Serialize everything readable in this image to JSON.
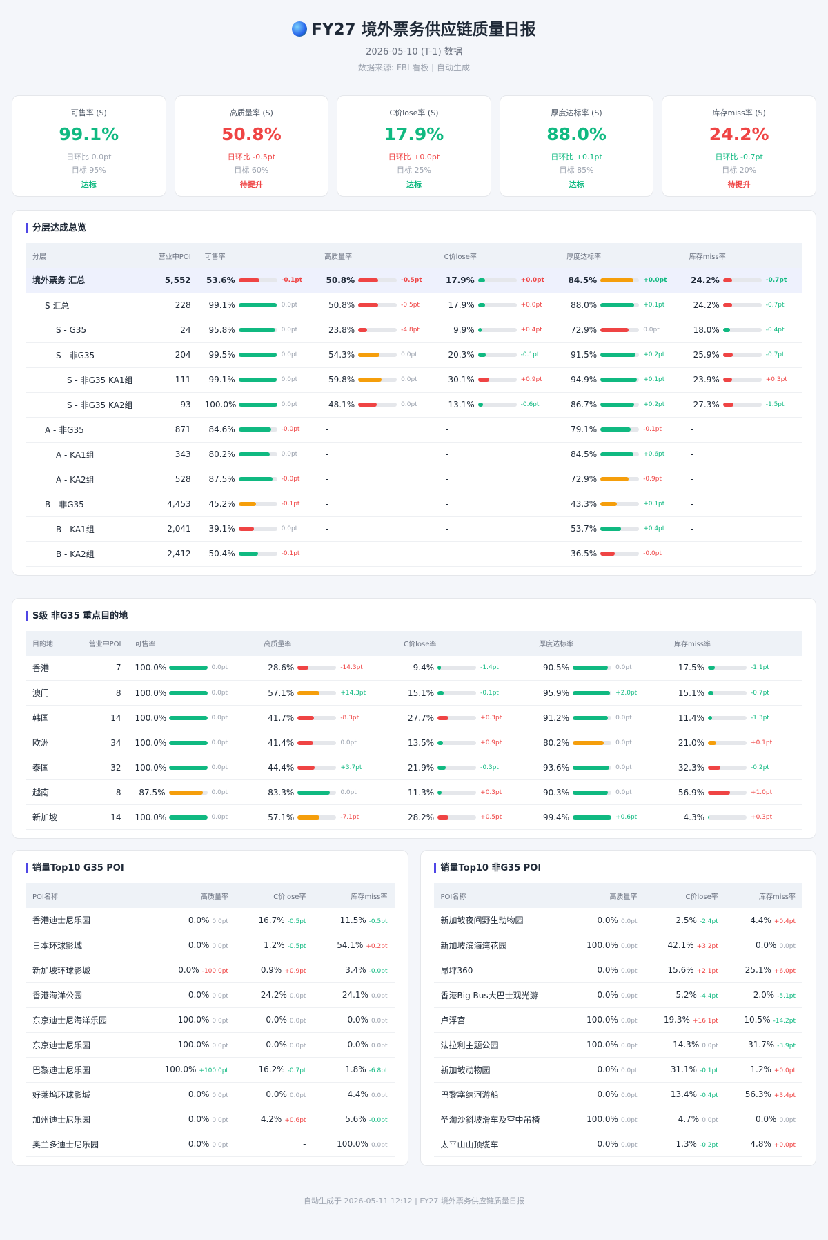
{
  "header": {
    "title": "FY27 境外票务供应链质量日报",
    "date_line": "2026-05-10 (T-1) 数据",
    "source_line": "数据来源: FBI 看板 | 自动生成"
  },
  "kpis": [
    {
      "title": "可售率 (S)",
      "value": "99.1%",
      "delta": "日环比 0.0pt",
      "target": "目标 95%",
      "status": "达标",
      "value_color": "green",
      "delta_color": "gray",
      "status_color": "green"
    },
    {
      "title": "高质量率 (S)",
      "value": "50.8%",
      "delta": "日环比 -0.5pt",
      "target": "目标 60%",
      "status": "待提升",
      "value_color": "red",
      "delta_color": "red",
      "status_color": "red"
    },
    {
      "title": "C价lose率 (S)",
      "value": "17.9%",
      "delta": "日环比 +0.0pt",
      "target": "目标 25%",
      "status": "达标",
      "value_color": "green",
      "delta_color": "red",
      "status_color": "green"
    },
    {
      "title": "厚度达标率 (S)",
      "value": "88.0%",
      "delta": "日环比 +0.1pt",
      "target": "目标 85%",
      "status": "达标",
      "value_color": "green",
      "delta_color": "green",
      "status_color": "green"
    },
    {
      "title": "库存miss率 (S)",
      "value": "24.2%",
      "delta": "日环比 -0.7pt",
      "target": "目标 20%",
      "status": "待提升",
      "value_color": "red",
      "delta_color": "green",
      "status_color": "red"
    }
  ],
  "colors": {
    "green": "#10b981",
    "red": "#ef4444",
    "orange": "#f59e0b",
    "gray": "#9ca3af"
  },
  "tier_section": {
    "title": "分层达成总览",
    "columns": [
      "分层",
      "营业中POI",
      "可售率",
      "高质量率",
      "C价lose率",
      "厚度达标率",
      "库存miss率"
    ],
    "rows": [
      {
        "name": "境外票务 汇总",
        "indent": 0,
        "summary": true,
        "poi": "5,552",
        "m": [
          [
            "53.6%",
            "-0.1pt",
            "red",
            "red"
          ],
          [
            "50.8%",
            "-0.5pt",
            "red",
            "red"
          ],
          [
            "17.9%",
            "+0.0pt",
            "green",
            "red"
          ],
          [
            "84.5%",
            "+0.0pt",
            "orange",
            "green"
          ],
          [
            "24.2%",
            "-0.7pt",
            "red",
            "green"
          ]
        ]
      },
      {
        "name": "S 汇总",
        "indent": 1,
        "poi": "228",
        "m": [
          [
            "99.1%",
            "0.0pt",
            "green",
            "gray"
          ],
          [
            "50.8%",
            "-0.5pt",
            "red",
            "red"
          ],
          [
            "17.9%",
            "+0.0pt",
            "green",
            "red"
          ],
          [
            "88.0%",
            "+0.1pt",
            "green",
            "green"
          ],
          [
            "24.2%",
            "-0.7pt",
            "red",
            "green"
          ]
        ]
      },
      {
        "name": "S - G35",
        "indent": 2,
        "poi": "24",
        "m": [
          [
            "95.8%",
            "0.0pt",
            "green",
            "gray"
          ],
          [
            "23.8%",
            "-4.8pt",
            "red",
            "red"
          ],
          [
            "9.9%",
            "+0.4pt",
            "green",
            "red"
          ],
          [
            "72.9%",
            "0.0pt",
            "red",
            "gray"
          ],
          [
            "18.0%",
            "-0.4pt",
            "green",
            "green"
          ]
        ]
      },
      {
        "name": "S - 非G35",
        "indent": 2,
        "poi": "204",
        "m": [
          [
            "99.5%",
            "0.0pt",
            "green",
            "gray"
          ],
          [
            "54.3%",
            "0.0pt",
            "orange",
            "gray"
          ],
          [
            "20.3%",
            "-0.1pt",
            "green",
            "green"
          ],
          [
            "91.5%",
            "+0.2pt",
            "green",
            "green"
          ],
          [
            "25.9%",
            "-0.7pt",
            "red",
            "green"
          ]
        ]
      },
      {
        "name": "S - 非G35 KA1组",
        "indent": 3,
        "poi": "111",
        "m": [
          [
            "99.1%",
            "0.0pt",
            "green",
            "gray"
          ],
          [
            "59.8%",
            "0.0pt",
            "orange",
            "gray"
          ],
          [
            "30.1%",
            "+0.9pt",
            "red",
            "red"
          ],
          [
            "94.9%",
            "+0.1pt",
            "green",
            "green"
          ],
          [
            "23.9%",
            "+0.3pt",
            "red",
            "red"
          ]
        ]
      },
      {
        "name": "S - 非G35 KA2组",
        "indent": 3,
        "poi": "93",
        "m": [
          [
            "100.0%",
            "0.0pt",
            "green",
            "gray"
          ],
          [
            "48.1%",
            "0.0pt",
            "red",
            "gray"
          ],
          [
            "13.1%",
            "-0.6pt",
            "green",
            "green"
          ],
          [
            "86.7%",
            "+0.2pt",
            "green",
            "green"
          ],
          [
            "27.3%",
            "-1.5pt",
            "red",
            "green"
          ]
        ]
      },
      {
        "name": "A - 非G35",
        "indent": 1,
        "poi": "871",
        "m": [
          [
            "84.6%",
            "-0.0pt",
            "green",
            "red"
          ],
          null,
          null,
          [
            "79.1%",
            "-0.1pt",
            "green",
            "red"
          ],
          null
        ]
      },
      {
        "name": "A - KA1组",
        "indent": 2,
        "poi": "343",
        "m": [
          [
            "80.2%",
            "0.0pt",
            "green",
            "gray"
          ],
          null,
          null,
          [
            "84.5%",
            "+0.6pt",
            "green",
            "green"
          ],
          null
        ]
      },
      {
        "name": "A - KA2组",
        "indent": 2,
        "poi": "528",
        "m": [
          [
            "87.5%",
            "-0.0pt",
            "green",
            "red"
          ],
          null,
          null,
          [
            "72.9%",
            "-0.9pt",
            "orange",
            "red"
          ],
          null
        ]
      },
      {
        "name": "B - 非G35",
        "indent": 1,
        "poi": "4,453",
        "m": [
          [
            "45.2%",
            "-0.1pt",
            "orange",
            "red"
          ],
          null,
          null,
          [
            "43.3%",
            "+0.1pt",
            "orange",
            "green"
          ],
          null
        ]
      },
      {
        "name": "B - KA1组",
        "indent": 2,
        "poi": "2,041",
        "m": [
          [
            "39.1%",
            "0.0pt",
            "red",
            "gray"
          ],
          null,
          null,
          [
            "53.7%",
            "+0.4pt",
            "green",
            "green"
          ],
          null
        ]
      },
      {
        "name": "B - KA2组",
        "indent": 2,
        "poi": "2,412",
        "m": [
          [
            "50.4%",
            "-0.1pt",
            "green",
            "red"
          ],
          null,
          null,
          [
            "36.5%",
            "-0.0pt",
            "red",
            "red"
          ],
          null
        ]
      }
    ],
    "dash": "-"
  },
  "dest_section": {
    "title": "S级 非G35 重点目的地",
    "columns": [
      "目的地",
      "营业中POI",
      "可售率",
      "高质量率",
      "C价lose率",
      "厚度达标率",
      "库存miss率"
    ],
    "rows": [
      {
        "name": "香港",
        "poi": "7",
        "m": [
          [
            "100.0%",
            "0.0pt",
            "green",
            "gray"
          ],
          [
            "28.6%",
            "-14.3pt",
            "red",
            "red"
          ],
          [
            "9.4%",
            "-1.4pt",
            "green",
            "green"
          ],
          [
            "90.5%",
            "0.0pt",
            "green",
            "gray"
          ],
          [
            "17.5%",
            "-1.1pt",
            "green",
            "green"
          ]
        ]
      },
      {
        "name": "澳门",
        "poi": "8",
        "m": [
          [
            "100.0%",
            "0.0pt",
            "green",
            "gray"
          ],
          [
            "57.1%",
            "+14.3pt",
            "orange",
            "green"
          ],
          [
            "15.1%",
            "-0.1pt",
            "green",
            "green"
          ],
          [
            "95.9%",
            "+2.0pt",
            "green",
            "green"
          ],
          [
            "15.1%",
            "-0.7pt",
            "green",
            "green"
          ]
        ]
      },
      {
        "name": "韩国",
        "poi": "14",
        "m": [
          [
            "100.0%",
            "0.0pt",
            "green",
            "gray"
          ],
          [
            "41.7%",
            "-8.3pt",
            "red",
            "red"
          ],
          [
            "27.7%",
            "+0.3pt",
            "red",
            "red"
          ],
          [
            "91.2%",
            "0.0pt",
            "green",
            "gray"
          ],
          [
            "11.4%",
            "-1.3pt",
            "green",
            "green"
          ]
        ]
      },
      {
        "name": "欧洲",
        "poi": "34",
        "m": [
          [
            "100.0%",
            "0.0pt",
            "green",
            "gray"
          ],
          [
            "41.4%",
            "0.0pt",
            "red",
            "gray"
          ],
          [
            "13.5%",
            "+0.9pt",
            "green",
            "red"
          ],
          [
            "80.2%",
            "0.0pt",
            "orange",
            "gray"
          ],
          [
            "21.0%",
            "+0.1pt",
            "orange",
            "red"
          ]
        ]
      },
      {
        "name": "泰国",
        "poi": "32",
        "m": [
          [
            "100.0%",
            "0.0pt",
            "green",
            "gray"
          ],
          [
            "44.4%",
            "+3.7pt",
            "red",
            "green"
          ],
          [
            "21.9%",
            "-0.3pt",
            "green",
            "green"
          ],
          [
            "93.6%",
            "0.0pt",
            "green",
            "gray"
          ],
          [
            "32.3%",
            "-0.2pt",
            "red",
            "green"
          ]
        ]
      },
      {
        "name": "越南",
        "poi": "8",
        "m": [
          [
            "87.5%",
            "0.0pt",
            "orange",
            "gray"
          ],
          [
            "83.3%",
            "0.0pt",
            "green",
            "gray"
          ],
          [
            "11.3%",
            "+0.3pt",
            "green",
            "red"
          ],
          [
            "90.3%",
            "0.0pt",
            "green",
            "gray"
          ],
          [
            "56.9%",
            "+1.0pt",
            "red",
            "red"
          ]
        ]
      },
      {
        "name": "新加坡",
        "poi": "14",
        "m": [
          [
            "100.0%",
            "0.0pt",
            "green",
            "gray"
          ],
          [
            "57.1%",
            "-7.1pt",
            "orange",
            "red"
          ],
          [
            "28.2%",
            "+0.5pt",
            "red",
            "red"
          ],
          [
            "99.4%",
            "+0.6pt",
            "green",
            "green"
          ],
          [
            "4.3%",
            "+0.3pt",
            "green",
            "red"
          ]
        ]
      }
    ]
  },
  "top_g35": {
    "title": "销量Top10 G35 POI",
    "columns": [
      "POI名称",
      "高质量率",
      "C价lose率",
      "库存miss率"
    ],
    "rows": [
      {
        "name": "香港迪士尼乐园",
        "c": [
          [
            "0.0%",
            "0.0pt",
            "gray"
          ],
          [
            "16.7%",
            "-0.5pt",
            "green"
          ],
          [
            "11.5%",
            "-0.5pt",
            "green"
          ]
        ]
      },
      {
        "name": "日本环球影城",
        "c": [
          [
            "0.0%",
            "0.0pt",
            "gray"
          ],
          [
            "1.2%",
            "-0.5pt",
            "green"
          ],
          [
            "54.1%",
            "+0.2pt",
            "red"
          ]
        ]
      },
      {
        "name": "新加坡环球影城",
        "c": [
          [
            "0.0%",
            "-100.0pt",
            "red"
          ],
          [
            "0.9%",
            "+0.9pt",
            "red"
          ],
          [
            "3.4%",
            "-0.0pt",
            "green"
          ]
        ]
      },
      {
        "name": "香港海洋公园",
        "c": [
          [
            "0.0%",
            "0.0pt",
            "gray"
          ],
          [
            "24.2%",
            "0.0pt",
            "gray"
          ],
          [
            "24.1%",
            "0.0pt",
            "gray"
          ]
        ]
      },
      {
        "name": "东京迪士尼海洋乐园",
        "c": [
          [
            "100.0%",
            "0.0pt",
            "gray"
          ],
          [
            "0.0%",
            "0.0pt",
            "gray"
          ],
          [
            "0.0%",
            "0.0pt",
            "gray"
          ]
        ]
      },
      {
        "name": "东京迪士尼乐园",
        "c": [
          [
            "100.0%",
            "0.0pt",
            "gray"
          ],
          [
            "0.0%",
            "0.0pt",
            "gray"
          ],
          [
            "0.0%",
            "0.0pt",
            "gray"
          ]
        ]
      },
      {
        "name": "巴黎迪士尼乐园",
        "c": [
          [
            "100.0%",
            "+100.0pt",
            "green"
          ],
          [
            "16.2%",
            "-0.7pt",
            "green"
          ],
          [
            "1.8%",
            "-6.8pt",
            "green"
          ]
        ]
      },
      {
        "name": "好莱坞环球影城",
        "c": [
          [
            "0.0%",
            "0.0pt",
            "gray"
          ],
          [
            "0.0%",
            "0.0pt",
            "gray"
          ],
          [
            "4.4%",
            "0.0pt",
            "gray"
          ]
        ]
      },
      {
        "name": "加州迪士尼乐园",
        "c": [
          [
            "0.0%",
            "0.0pt",
            "gray"
          ],
          [
            "4.2%",
            "+0.6pt",
            "red"
          ],
          [
            "5.6%",
            "-0.0pt",
            "green"
          ]
        ]
      },
      {
        "name": "奥兰多迪士尼乐园",
        "c": [
          [
            "0.0%",
            "0.0pt",
            "gray"
          ],
          null,
          [
            "100.0%",
            "0.0pt",
            "gray"
          ]
        ]
      }
    ]
  },
  "top_non_g35": {
    "title": "销量Top10 非G35 POI",
    "columns": [
      "POI名称",
      "高质量率",
      "C价lose率",
      "库存miss率"
    ],
    "rows": [
      {
        "name": "新加坡夜间野生动物园",
        "c": [
          [
            "0.0%",
            "0.0pt",
            "gray"
          ],
          [
            "2.5%",
            "-2.4pt",
            "green"
          ],
          [
            "4.4%",
            "+0.4pt",
            "red"
          ]
        ]
      },
      {
        "name": "新加坡滨海湾花园",
        "c": [
          [
            "100.0%",
            "0.0pt",
            "gray"
          ],
          [
            "42.1%",
            "+3.2pt",
            "red"
          ],
          [
            "0.0%",
            "0.0pt",
            "gray"
          ]
        ]
      },
      {
        "name": "昂坪360",
        "c": [
          [
            "0.0%",
            "0.0pt",
            "gray"
          ],
          [
            "15.6%",
            "+2.1pt",
            "red"
          ],
          [
            "25.1%",
            "+6.0pt",
            "red"
          ]
        ]
      },
      {
        "name": "香港Big Bus大巴士观光游",
        "c": [
          [
            "0.0%",
            "0.0pt",
            "gray"
          ],
          [
            "5.2%",
            "-4.4pt",
            "green"
          ],
          [
            "2.0%",
            "-5.1pt",
            "green"
          ]
        ]
      },
      {
        "name": "卢浮宫",
        "c": [
          [
            "100.0%",
            "0.0pt",
            "gray"
          ],
          [
            "19.3%",
            "+16.1pt",
            "red"
          ],
          [
            "10.5%",
            "-14.2pt",
            "green"
          ]
        ]
      },
      {
        "name": "法拉利主题公园",
        "c": [
          [
            "100.0%",
            "0.0pt",
            "gray"
          ],
          [
            "14.3%",
            "0.0pt",
            "gray"
          ],
          [
            "31.7%",
            "-3.9pt",
            "green"
          ]
        ]
      },
      {
        "name": "新加坡动物园",
        "c": [
          [
            "0.0%",
            "0.0pt",
            "gray"
          ],
          [
            "31.1%",
            "-0.1pt",
            "green"
          ],
          [
            "1.2%",
            "+0.0pt",
            "red"
          ]
        ]
      },
      {
        "name": "巴黎塞纳河游船",
        "c": [
          [
            "0.0%",
            "0.0pt",
            "gray"
          ],
          [
            "13.4%",
            "-0.4pt",
            "green"
          ],
          [
            "56.3%",
            "+3.4pt",
            "red"
          ]
        ]
      },
      {
        "name": "圣淘沙斜坡滑车及空中吊椅",
        "c": [
          [
            "100.0%",
            "0.0pt",
            "gray"
          ],
          [
            "4.7%",
            "0.0pt",
            "gray"
          ],
          [
            "0.0%",
            "0.0pt",
            "gray"
          ]
        ]
      },
      {
        "name": "太平山山顶缆车",
        "c": [
          [
            "0.0%",
            "0.0pt",
            "gray"
          ],
          [
            "1.3%",
            "-0.2pt",
            "green"
          ],
          [
            "4.8%",
            "+0.0pt",
            "red"
          ]
        ]
      }
    ]
  },
  "footer": "自动生成于 2026-05-11 12:12 | FY27 境外票务供应链质量日报"
}
